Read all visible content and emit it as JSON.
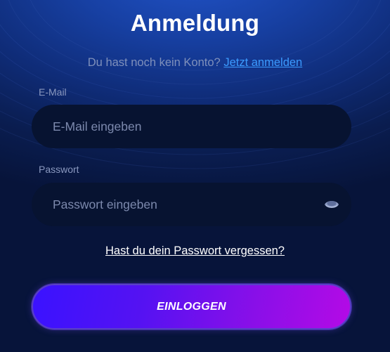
{
  "title": "Anmeldung",
  "signup": {
    "prompt": "Du hast noch kein Konto?",
    "link": "Jetzt anmelden"
  },
  "email": {
    "label": "E-Mail",
    "placeholder": "E-Mail eingeben",
    "value": ""
  },
  "password": {
    "label": "Passwort",
    "placeholder": "Passwort eingeben",
    "value": "",
    "toggle_icon": "eye-icon"
  },
  "forgot_link": "Hast du dein Passwort vergessen?",
  "login_button": "EINLOGGEN",
  "colors": {
    "link": "#3b9bff",
    "field_bg": "#071331",
    "button_gradient_start": "#3a12ff",
    "button_gradient_end": "#b40ae6"
  }
}
